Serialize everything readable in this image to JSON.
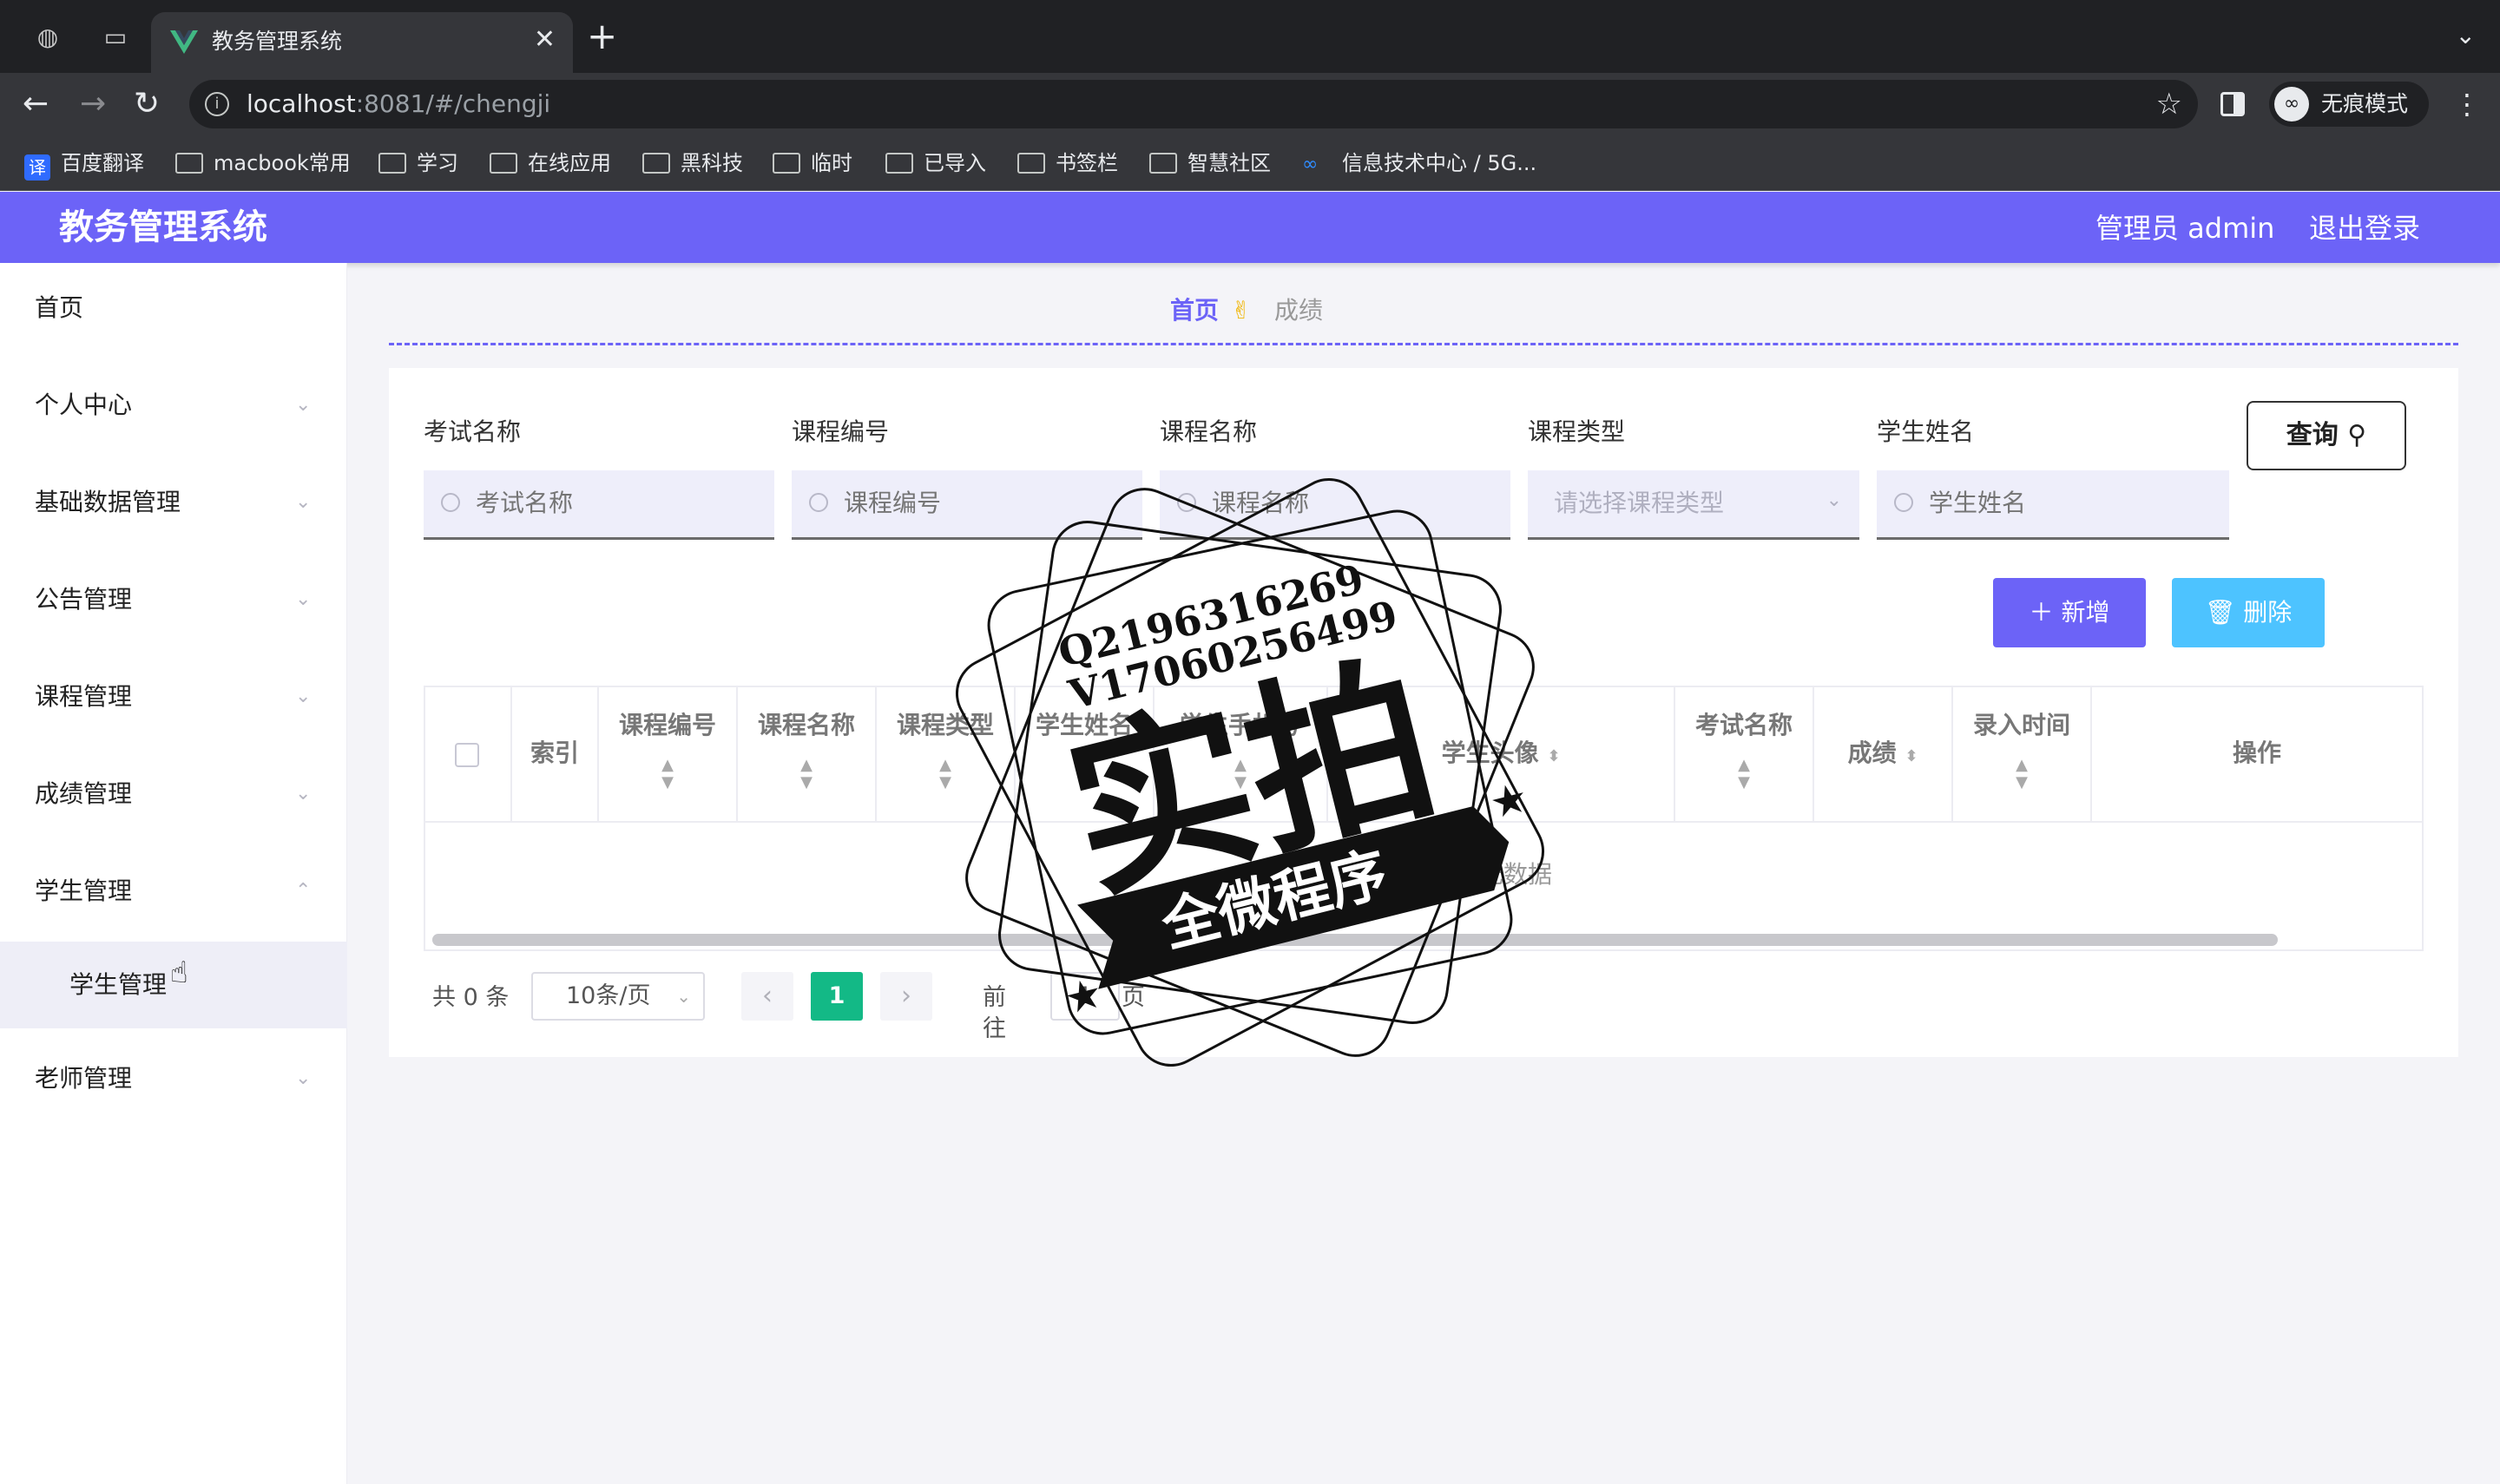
{
  "browser": {
    "tab_title": "教务管理系统",
    "url_host": "localhost",
    "url_rest": ":8081/#/chengji",
    "profile_label": "无痕模式",
    "bookmarks": [
      {
        "label": "百度翻译",
        "icon": "translate-badge",
        "badge": "译"
      },
      {
        "label": "macbook常用",
        "icon": "folder-icon"
      },
      {
        "label": "学习",
        "icon": "folder-icon"
      },
      {
        "label": "在线应用",
        "icon": "folder-icon"
      },
      {
        "label": "黑科技",
        "icon": "folder-icon"
      },
      {
        "label": "临时",
        "icon": "folder-icon"
      },
      {
        "label": "已导入",
        "icon": "folder-icon"
      },
      {
        "label": "书签栏",
        "icon": "folder-icon"
      },
      {
        "label": "智慧社区",
        "icon": "folder-icon"
      },
      {
        "label": "信息技术中心 / 5G...",
        "icon": "infinity-icon"
      }
    ]
  },
  "header": {
    "brand": "教务管理系统",
    "user": "管理员 admin",
    "logout": "退出登录",
    "color": "#6c63f7"
  },
  "sidebar": {
    "items": [
      {
        "label": "首页",
        "has_arrow": false
      },
      {
        "label": "个人中心",
        "has_arrow": true
      },
      {
        "label": "基础数据管理",
        "has_arrow": true
      },
      {
        "label": "公告管理",
        "has_arrow": true
      },
      {
        "label": "课程管理",
        "has_arrow": true
      },
      {
        "label": "成绩管理",
        "has_arrow": true
      },
      {
        "label": "学生管理",
        "has_arrow": true,
        "expanded": true
      },
      {
        "label": "老师管理",
        "has_arrow": true
      }
    ],
    "sub_item": "学生管理"
  },
  "breadcrumb": {
    "home": "首页",
    "separator": "✌",
    "current": "成绩"
  },
  "filters": [
    {
      "label": "考试名称",
      "placeholder": "考试名称",
      "type": "text"
    },
    {
      "label": "课程编号",
      "placeholder": "课程编号",
      "type": "text"
    },
    {
      "label": "课程名称",
      "placeholder": "课程名称",
      "type": "text"
    },
    {
      "label": "课程类型",
      "placeholder": "请选择课程类型",
      "type": "select"
    },
    {
      "label": "学生姓名",
      "placeholder": "学生姓名",
      "type": "text"
    }
  ],
  "buttons": {
    "query": "查询",
    "add": "新增",
    "delete": "删除"
  },
  "table": {
    "columns": [
      {
        "label": "索引",
        "sortable": false
      },
      {
        "label": "课程编号",
        "sortable": true
      },
      {
        "label": "课程名称",
        "sortable": true
      },
      {
        "label": "课程类型",
        "sortable": true
      },
      {
        "label": "学生姓名",
        "sortable": true
      },
      {
        "label": "学生手机号",
        "sortable": true
      },
      {
        "label": "学生头像",
        "sortable": true
      },
      {
        "label": "考试名称",
        "sortable": true
      },
      {
        "label": "成绩",
        "sortable": true
      },
      {
        "label": "录入时间",
        "sortable": true
      },
      {
        "label": "操作",
        "sortable": false
      }
    ],
    "empty_text": "暂无数据"
  },
  "pagination": {
    "total": "共 0 条",
    "page_size": "10条/页",
    "current_page": "1",
    "goto_prefix": "前往",
    "goto_value": "1",
    "goto_suffix": "页"
  },
  "watermark": {
    "line1": "Q2196316269",
    "line2": "V17060256499",
    "main": "实拍",
    "banner": "全微程序"
  }
}
